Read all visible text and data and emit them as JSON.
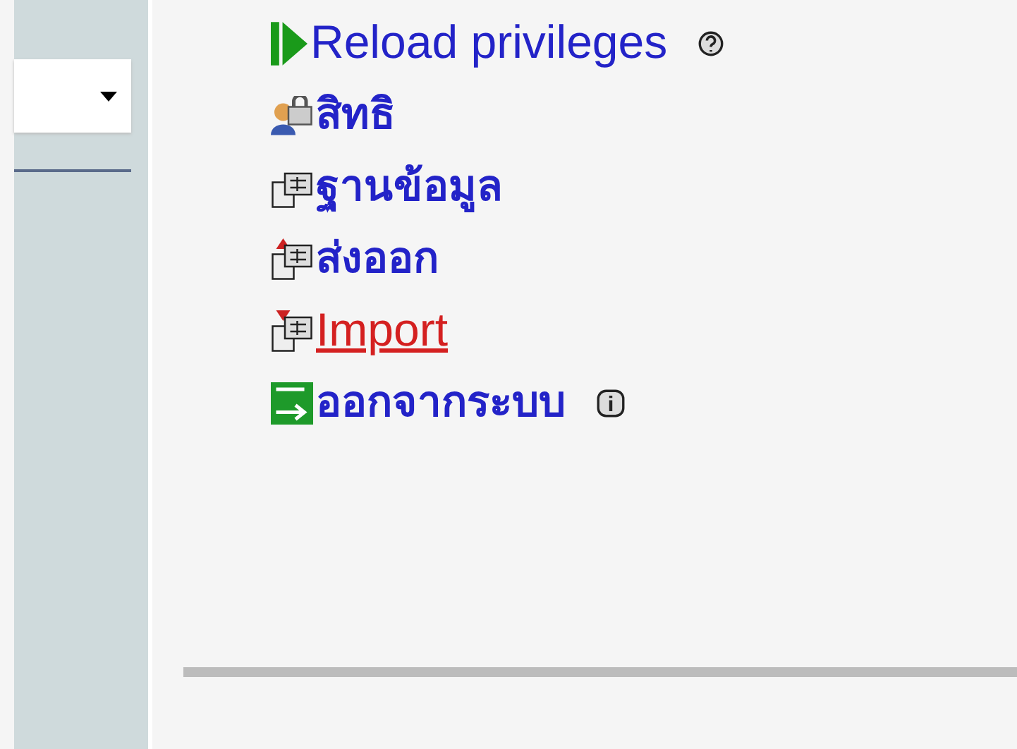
{
  "menu": {
    "items": [
      {
        "label": "Reload privileges",
        "highlighted": false,
        "bold": false
      },
      {
        "label": "สิทธิ",
        "highlighted": false,
        "bold": true
      },
      {
        "label": "ฐานข้อมูล",
        "highlighted": false,
        "bold": true
      },
      {
        "label": "ส่งออก",
        "highlighted": false,
        "bold": true
      },
      {
        "label": "Import",
        "highlighted": true,
        "bold": false
      },
      {
        "label": "ออกจากระบบ",
        "highlighted": false,
        "bold": true
      }
    ]
  }
}
